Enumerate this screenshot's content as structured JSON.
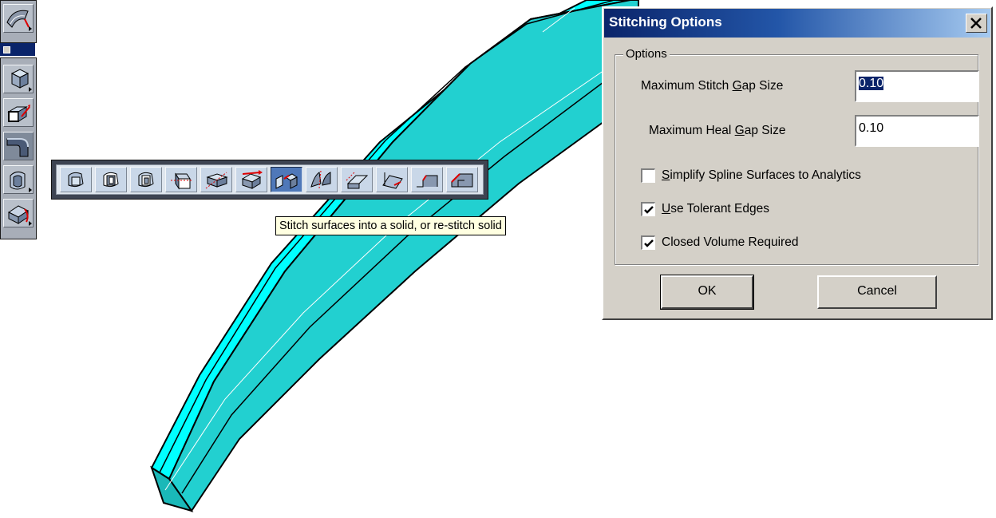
{
  "dialog": {
    "title": "Stitching Options",
    "group_label": "Options",
    "max_stitch_gap": {
      "label_before": "Maximum Stitch ",
      "mnemonic": "G",
      "label_after": "ap Size",
      "value": "0.10"
    },
    "max_heal_gap": {
      "label_before": "Maximum Heal ",
      "mnemonic": "G",
      "label_after": "ap Size",
      "value": "0.10"
    },
    "checkboxes": [
      {
        "mnemonic": "S",
        "label_rest": "implify Spline Surfaces to Analytics",
        "checked": false
      },
      {
        "mnemonic": "U",
        "label_rest": "se Tolerant Edges",
        "checked": true
      },
      {
        "mnemonic": "",
        "label_rest": "Closed Volume Required",
        "checked": true
      }
    ],
    "ok_label": "OK",
    "cancel_label": "Cancel"
  },
  "tooltip": "Stitch surfaces into a solid, or re-stitch solid",
  "colors": {
    "model_face": "#00ffff",
    "model_side": "#20c8c8",
    "title_start": "#0a246a",
    "title_end": "#a6caf0",
    "flyout_active": "#4f78b9"
  },
  "icons": {
    "vertical_toolbar": [
      "surface-icon",
      "toolbar-grip-icon",
      "solid-primitive-icon",
      "extrude-icon",
      "fillet-icon",
      "shell-icon",
      "modify-face-icon"
    ],
    "flyout": [
      "solid-cube-icon",
      "hollow-solid-icon",
      "shell-solid-icon",
      "thin-shell-icon",
      "cut-solid-icon",
      "heal-solid-icon",
      "stitch-surfaces-icon",
      "split-solid-icon",
      "offset-face-icon",
      "taper-face-icon",
      "chamfer-edge-icon",
      "blend-edge-icon"
    ]
  }
}
